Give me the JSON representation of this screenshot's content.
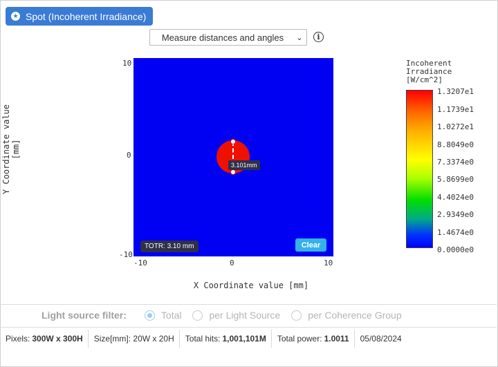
{
  "header": {
    "title": "Spot (Incoherent Irradiance)",
    "icon": "star-icon"
  },
  "toolbar": {
    "mode_selected": "Measure distances and angles",
    "info_icon": "info-icon"
  },
  "plot": {
    "ylabel": "Y Coordinate value [mm]",
    "xlabel": "X Coordinate value [mm]",
    "y_ticks": [
      "10",
      "0",
      "-10"
    ],
    "x_ticks": [
      "-10",
      "0",
      "10"
    ],
    "background_color": "#0000f2",
    "spot_color": "#ee1000",
    "measurement_label": "3.101mm",
    "totr_label": "TOTR: 3.10 mm",
    "clear_label": "Clear"
  },
  "colorbar": {
    "title_lines": [
      "Incoherent",
      "Irradiance",
      "[W/cm^2]"
    ],
    "ticks": [
      "1.3207e1",
      "1.1739e1",
      "1.0272e1",
      "8.8049e0",
      "7.3374e0",
      "5.8699e0",
      "4.4024e0",
      "2.9349e0",
      "1.4674e0",
      "0.0000e0"
    ]
  },
  "filter": {
    "label": "Light source filter:",
    "options": [
      "Total",
      "per Light Source",
      "per Coherence Group"
    ],
    "selected": "Total"
  },
  "status": {
    "pixels_label": "Pixels:",
    "pixels_value": "300W x 300H",
    "size_text": "Size[mm]: 20W x 20H",
    "hits_label": "Total hits:",
    "hits_value": "1,001,101M",
    "power_label": "Total power:",
    "power_value": "1.0011",
    "date": "05/08/2024"
  }
}
